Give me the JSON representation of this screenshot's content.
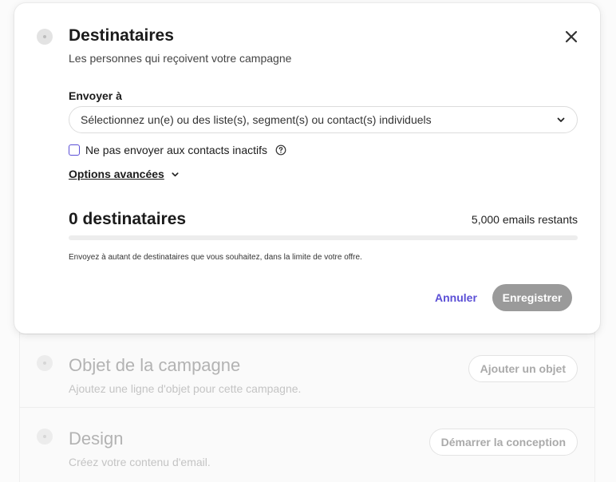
{
  "recipients": {
    "title": "Destinataires",
    "subtitle": "Les personnes qui reçoivent votre campagne",
    "send_to_label": "Envoyer à",
    "select_placeholder": "Sélectionnez un(e) ou des liste(s), segment(s) ou contact(s) individuels",
    "inactive_checkbox_label": "Ne pas envoyer aux contacts inactifs",
    "inactive_checked": false,
    "advanced_options_label": "Options avancées",
    "recipient_count": "0 destinataires",
    "emails_remaining": "5,000 emails restants",
    "usage_fraction": 0,
    "hint": "Envoyez à autant de destinataires que vous souhaitez, dans la limite de votre offre.",
    "cancel_label": "Annuler",
    "save_label": "Enregistrer"
  },
  "background_sections": [
    {
      "title": "Objet de la campagne",
      "subtitle": "Ajoutez une ligne d'objet pour cette campagne.",
      "button": "Ajouter un objet"
    },
    {
      "title": "Design",
      "subtitle": "Créez votre contenu d'email.",
      "button": "Démarrer la conception"
    }
  ],
  "colors": {
    "accent": "#5b4fd6",
    "save_button_disabled": "#9a9a9a"
  },
  "icons": {
    "close": "close-icon",
    "select_chevron": "chevron-down-icon",
    "help": "question-circle-icon",
    "advanced_chevron": "chevron-down-icon"
  }
}
